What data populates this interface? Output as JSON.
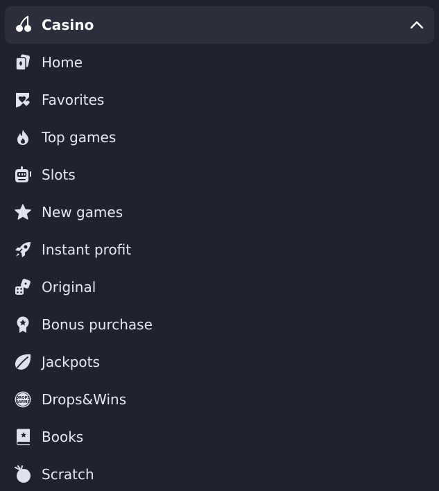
{
  "colors": {
    "background": "#1f2330",
    "header_background": "#2b2f3c",
    "text": "#e6e8ef",
    "icon": "#dfe2ea"
  },
  "header": {
    "label": "Casino",
    "icon": "cherries-icon",
    "expanded": true,
    "toggle_icon": "chevron-up-icon"
  },
  "items": [
    {
      "label": "Home",
      "icon": "cards-icon"
    },
    {
      "label": "Favorites",
      "icon": "heart-bookmark-icon"
    },
    {
      "label": "Top games",
      "icon": "flame-icon"
    },
    {
      "label": "Slots",
      "icon": "slot-machine-icon"
    },
    {
      "label": "New games",
      "icon": "star-icon"
    },
    {
      "label": "Instant profit",
      "icon": "rocket-icon"
    },
    {
      "label": "Original",
      "icon": "dice-icon"
    },
    {
      "label": "Bonus purchase",
      "icon": "medal-icon"
    },
    {
      "label": "Jackpots",
      "icon": "leaf-coin-icon"
    },
    {
      "label": "Drops&Wins",
      "icon": "drops-wins-icon",
      "icon_text": "DROPS &WINS"
    },
    {
      "label": "Books",
      "icon": "book-icon"
    },
    {
      "label": "Scratch",
      "icon": "scratch-ball-icon"
    }
  ]
}
